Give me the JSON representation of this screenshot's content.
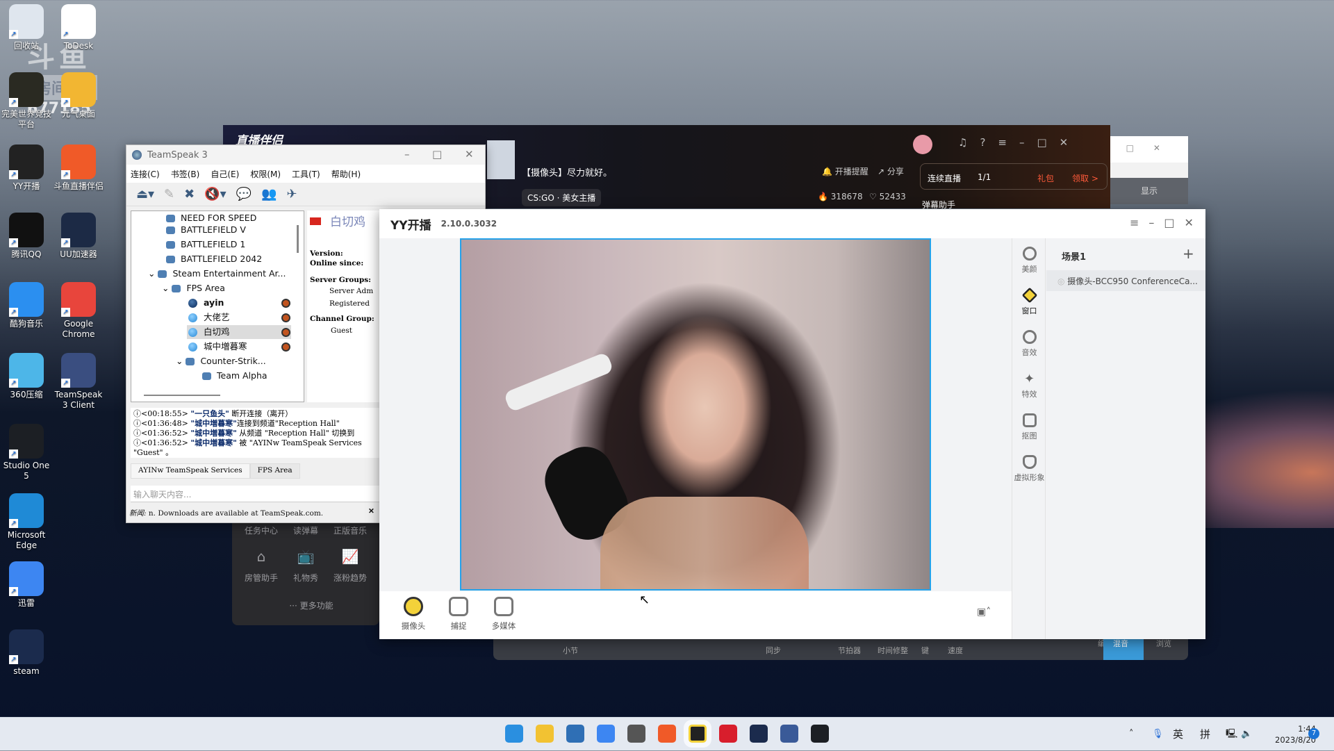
{
  "desktop": {
    "watermark": {
      "brand": "斗鱼",
      "label": "房间号",
      "room": "677185"
    },
    "icons": [
      {
        "label": "回收站",
        "icon": "recycle-bin-icon",
        "color": "#dfe6ee"
      },
      {
        "label": "ToDesk",
        "icon": "todesk-icon",
        "color": "#ffffff"
      },
      {
        "label": "完美世界竞技平台",
        "icon": "perfect-world-icon",
        "color": "#2a2a22"
      },
      {
        "label": "元气桌面",
        "icon": "yuanqi-icon",
        "color": "#f2b632"
      },
      {
        "label": "YY开播",
        "icon": "yy-live-icon",
        "color": "#222222"
      },
      {
        "label": "斗鱼直播伴侣",
        "icon": "douyu-icon",
        "color": "#f05a28"
      },
      {
        "label": "腾讯QQ",
        "icon": "qq-icon",
        "color": "#111111"
      },
      {
        "label": "UU加速器",
        "icon": "uu-icon",
        "color": "#1c2a45"
      },
      {
        "label": "酷狗音乐",
        "icon": "kugou-icon",
        "color": "#2b8ff0"
      },
      {
        "label": "Google Chrome",
        "icon": "chrome-icon",
        "color": "#e8453c"
      },
      {
        "label": "360压缩",
        "icon": "360zip-icon",
        "color": "#4db6e8"
      },
      {
        "label": "TeamSpeak 3 Client",
        "icon": "teamspeak-icon",
        "color": "#3a4e80"
      },
      {
        "label": "Studio One 5",
        "icon": "studio-one-icon",
        "color": "#1c1f24"
      },
      {
        "label": "Microsoft Edge",
        "icon": "edge-icon",
        "color": "#1f8ad6"
      },
      {
        "label": "迅雷",
        "icon": "xunlei-icon",
        "color": "#3d86f2"
      },
      {
        "label": "steam",
        "icon": "steam-icon",
        "color": "#1b2b4d"
      }
    ]
  },
  "douyu": {
    "logo": "直播伴侣",
    "stream_title": "【摄像头】尽力就好。",
    "category": "CS:GO · 美女主播",
    "remind": "开播提醒",
    "share": "分享",
    "hot": "318678",
    "likes": "52433",
    "streak_label": "连续直播",
    "streak_value": "1/1",
    "gift": "礼包",
    "claim": "领取 >",
    "danmu": "弹幕助手",
    "side": [
      "任务中心",
      "读弹幕",
      "正版音乐",
      "房管助手",
      "礼物秀",
      "涨粉趋势"
    ],
    "more": "··· 更多功能"
  },
  "other_window": {
    "tab": "显示"
  },
  "daw": {
    "labels": [
      "小节",
      "同步",
      "节拍器",
      "时间修整",
      "键",
      "速度"
    ],
    "tabs": [
      "编辑",
      "混音",
      "浏览"
    ]
  },
  "teamspeak": {
    "title": "TeamSpeak 3",
    "menu": [
      "连接(C)",
      "书签(B)",
      "自己(E)",
      "权限(M)",
      "工具(T)",
      "帮助(H)"
    ],
    "tree": [
      "NEED FOR SPEED",
      "BATTLEFIELD V",
      "BATTLEFIELD 1",
      "BATTLEFIELD 2042",
      "Steam Entertainment Ar...",
      "FPS Area",
      "ayin",
      "大佬艺",
      "白切鸡",
      "城中増暮寒",
      "Counter-Strik...",
      "Team Alpha"
    ],
    "info": {
      "name": "白切鸡",
      "version": "Version:",
      "online": "Online since:",
      "server_groups": "Server Groups:",
      "group1": "Server  Adm",
      "group2": "Registered",
      "channel_group": "Channel Group:",
      "channel_value": "Guest"
    },
    "log": [
      {
        "time": "<00:18:55>",
        "who": "\"一只鱼头\"",
        "text": " 断开连接（离开）"
      },
      {
        "time": "<01:36:48>",
        "who": "\"城中増暮寒\"",
        "text": "连接到频道\"Reception Hall\""
      },
      {
        "time": "<01:36:52>",
        "who": "\"城中増暮寒\"",
        "text": " 从频道 \"Reception Hall\" 切换到"
      },
      {
        "time": "<01:36:52>",
        "who": "\"城中増暮寒\"",
        "text": " 被 \"AYINw TeamSpeak Services"
      }
    ],
    "log_tail": "\"Guest\" 。",
    "tabs": [
      "AYINw TeamSpeak Services",
      "FPS Area"
    ],
    "chat_placeholder": "输入聊天内容...",
    "news_label": "新闻:",
    "news": " n. Downloads are available at TeamSpeak.com."
  },
  "yy": {
    "title": "YY开播",
    "version": "2.10.0.3032",
    "side": [
      "美颜",
      "窗口",
      "音效",
      "特效",
      "抠图",
      "虚拟形象"
    ],
    "active_side": "窗口",
    "scene": "场景1",
    "source": "摄像头-BCC950 ConferenceCa...",
    "tools": [
      "摄像头",
      "捕捉",
      "多媒体"
    ],
    "accent": "#25a2ea"
  },
  "taskbar": {
    "apps": [
      {
        "name": "start",
        "color": "#2a8fe0"
      },
      {
        "name": "file-explorer",
        "color": "#f2c232"
      },
      {
        "name": "store",
        "color": "#2f6fb5"
      },
      {
        "name": "xunlei",
        "color": "#3d86f2"
      },
      {
        "name": "app-hex",
        "color": "#555555"
      },
      {
        "name": "douyu",
        "color": "#f05a28"
      },
      {
        "name": "yy-live",
        "color": "#222222"
      },
      {
        "name": "netease-music",
        "color": "#d81e2c"
      },
      {
        "name": "steam",
        "color": "#1b2b4d"
      },
      {
        "name": "teamspeak",
        "color": "#3a5a98"
      },
      {
        "name": "studio-one",
        "color": "#1c1f24"
      }
    ],
    "ime_lang": "英",
    "ime_mode": "拼",
    "time": "1:44",
    "date": "2023/8/20",
    "notifications": "7"
  }
}
